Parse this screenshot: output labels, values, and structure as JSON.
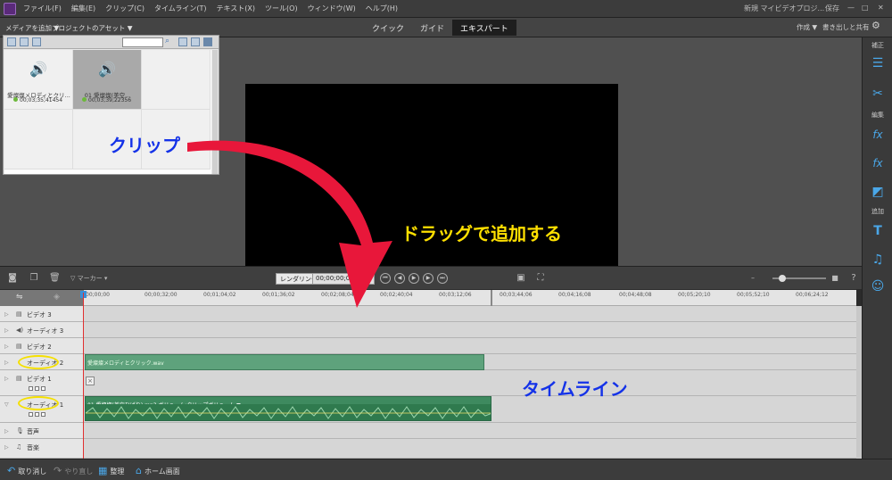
{
  "menubar": {
    "items": [
      "ファイル(F)",
      "編集(E)",
      "クリップ(C)",
      "タイムライン(T)",
      "テキスト(X)",
      "ツール(O)",
      "ウィンドウ(W)",
      "ヘルプ(H)"
    ],
    "project_title": "新規 マイビデオプロジ...",
    "save": "保存"
  },
  "toolbar": {
    "add_media": "メディアを追加 ▼",
    "project_assets": "プロジェクトのアセット ▼",
    "modes": [
      "クイック",
      "ガイド",
      "エキスパート"
    ],
    "active_mode": "エキスパート",
    "create": "作成 ▼",
    "export_share": "書き出しと共有"
  },
  "assets": {
    "clips": [
      {
        "name": "愛燦燦メロディとクリ...",
        "duration": "00;03;35;41454"
      },
      {
        "name": "01 愛燦燦(美空...",
        "duration": "00;03;39;22356"
      }
    ]
  },
  "sidebar": {
    "sections": [
      "補正",
      "編集",
      "追加"
    ]
  },
  "timeline_toolbar": {
    "marker": "マーカー",
    "render": "レンダリング",
    "timecode": "00;00;00;00"
  },
  "ruler": {
    "ticks": [
      "00;00;00",
      "00;00;32;00",
      "00;01;04;02",
      "00;01;36;02",
      "00;02;08;04",
      "00;02;40;04",
      "00;03;12;06",
      "00;03;44;06",
      "00;04;16;08",
      "00;04;48;08",
      "00;05;20;10",
      "00;05;52;10",
      "00;06;24;12"
    ]
  },
  "tracks": {
    "video3": "ビデオ 3",
    "audio3": "オーディオ 3",
    "video2": "ビデオ 2",
    "audio2": "オーディオ 2",
    "video1": "ビデオ 1",
    "audio1": "オーディオ 1",
    "narration": "音声",
    "music": "音楽"
  },
  "clips": {
    "audio2_clip": "愛燦燦メロディとクリック.wav",
    "audio1_clip": "01 愛燦燦(美空ひばり).mp3 ボリューム:クリップボリューム ▼"
  },
  "bottombar": {
    "undo": "取り消し",
    "redo": "やり直し",
    "organizer": "整理",
    "home": "ホーム画面"
  },
  "annotations": {
    "clip": "クリップ",
    "drag": "ドラッグで追加する",
    "timeline": "タイムライン"
  },
  "colors": {
    "annotation_blue": "#1432e8",
    "annotation_yellow": "#ffe000",
    "arrow_red": "#e8173a",
    "clip_green": "#5ea27c"
  }
}
